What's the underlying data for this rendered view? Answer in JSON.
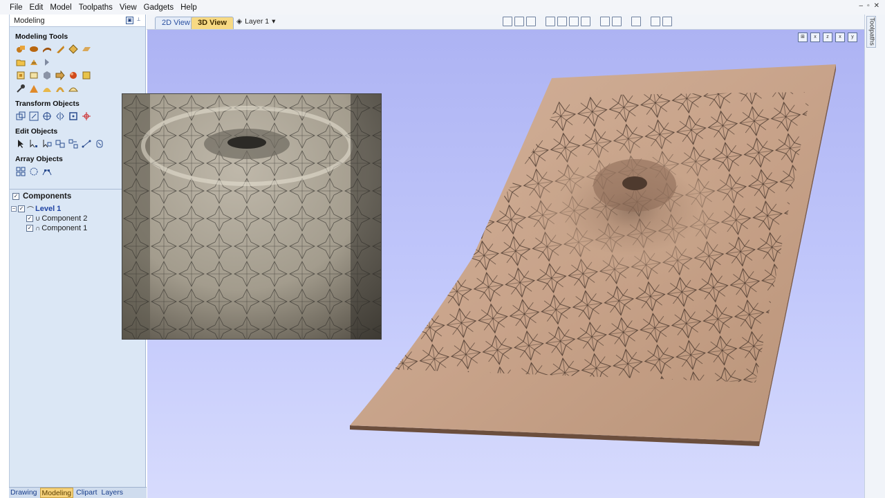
{
  "menu": {
    "items": [
      "File",
      "Edit",
      "Model",
      "Toolpaths",
      "View",
      "Gadgets",
      "Help"
    ]
  },
  "window_controls": [
    "–",
    "▫",
    "✕"
  ],
  "panel": {
    "title": "Modeling",
    "sections": {
      "modeling_tools": "Modeling Tools",
      "transform_objects": "Transform Objects",
      "edit_objects": "Edit Objects",
      "array_objects": "Array Objects"
    },
    "components": {
      "label": "Components",
      "tree": [
        {
          "label": "Level 1",
          "kind": "level"
        },
        {
          "label": "Component 2",
          "kind": "component"
        },
        {
          "label": "Component 1",
          "kind": "component"
        }
      ]
    },
    "bottom_tabs": [
      "Drawing",
      "Modeling",
      "Clipart",
      "Layers"
    ],
    "active_bottom_tab": "Modeling"
  },
  "toolbar": {
    "tab_2d": "2D View",
    "tab_3d": "3D View",
    "layer": "Layer 1"
  },
  "right_dock": {
    "toolpaths_tab": "Toolpaths"
  },
  "colors": {
    "viewport_top": "#adb3f3",
    "panel_bg": "#dbe7f5",
    "active_tab": "#f6d27b",
    "wood": "#c9a487"
  }
}
